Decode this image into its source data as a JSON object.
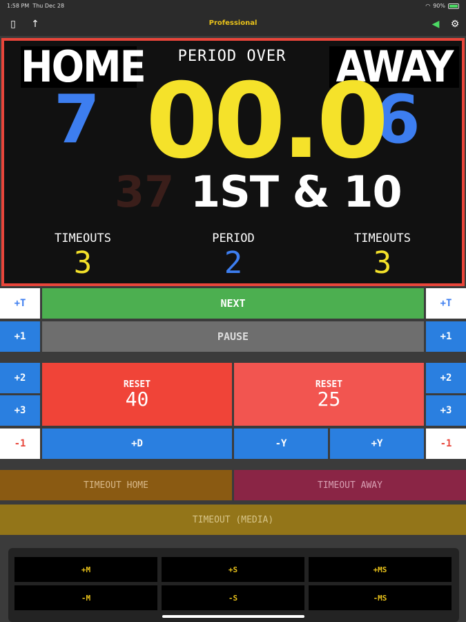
{
  "status": {
    "time": "1:58 PM",
    "date": "Thu Dec 28",
    "battery": "90%"
  },
  "toolbar": {
    "title": "Professional",
    "device_icon": "device-icon",
    "share_icon": "arrow-up-icon",
    "sound_icon": "speaker-icon",
    "settings_icon": "gear-icon"
  },
  "board": {
    "home_label": "HOME",
    "away_label": "AWAY",
    "home_score": "7",
    "away_score": "6",
    "clock": "00.0",
    "period_status": "PERIOD OVER",
    "down_distance": "1ST & 10",
    "play_clock": "37",
    "home_timeouts_label": "TIMEOUTS",
    "home_timeouts": "3",
    "period_label": "PERIOD",
    "period": "2",
    "away_timeouts_label": "TIMEOUTS",
    "away_timeouts": "3"
  },
  "controls": {
    "home_plus_t": "+T",
    "away_plus_t": "+T",
    "next": "NEXT",
    "home_plus1": "+1",
    "away_plus1": "+1",
    "pause": "PAUSE",
    "home_plus2": "+2",
    "away_plus2": "+2",
    "home_plus3": "+3",
    "away_plus3": "+3",
    "home_minus1": "-1",
    "away_minus1": "-1",
    "reset40_title": "RESET",
    "reset40_value": "40",
    "reset25_title": "RESET",
    "reset25_value": "25",
    "plus_d": "+D",
    "minus_y": "-Y",
    "plus_y": "+Y",
    "timeout_home": "TIMEOUT HOME",
    "timeout_away": "TIMEOUT AWAY",
    "timeout_media": "TIMEOUT (MEDIA)",
    "plus_m": "+M",
    "plus_s": "+S",
    "plus_ms": "+MS",
    "minus_m": "-M",
    "minus_s": "-S",
    "minus_ms": "-MS"
  }
}
